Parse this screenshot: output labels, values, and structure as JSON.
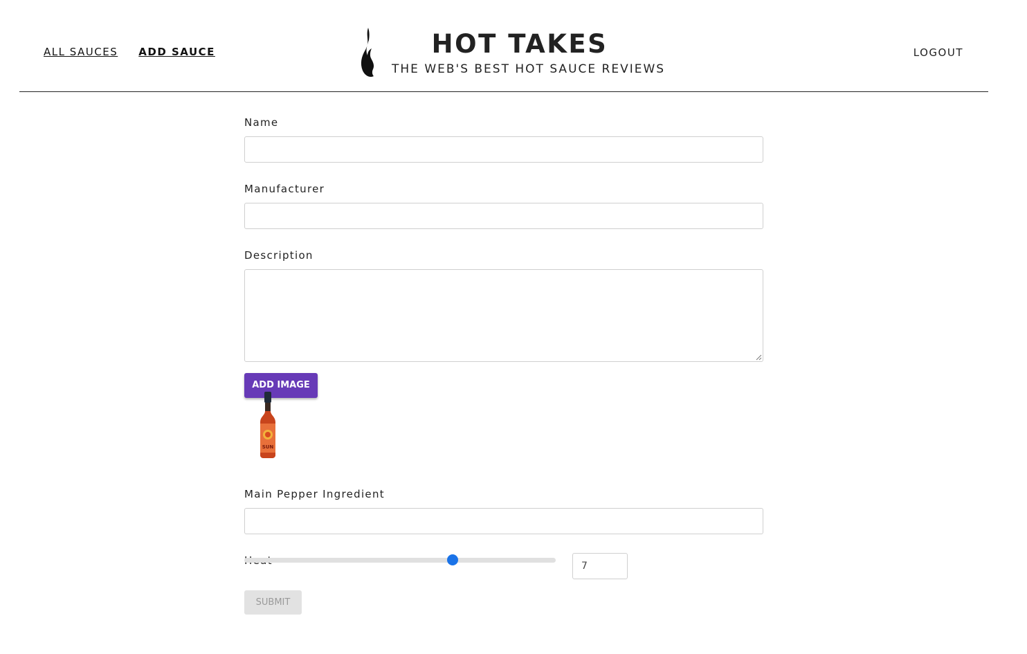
{
  "nav": {
    "all_sauces": "ALL SAUCES",
    "add_sauce": "ADD SAUCE",
    "logout": "LOGOUT"
  },
  "brand": {
    "title": "HOT TAKES",
    "subtitle": "THE WEB'S BEST HOT SAUCE REVIEWS",
    "logo_icon": "flame-icon"
  },
  "form": {
    "name_label": "Name",
    "name_value": "",
    "manufacturer_label": "Manufacturer",
    "manufacturer_value": "",
    "description_label": "Description",
    "description_value": "",
    "add_image_label": "ADD IMAGE",
    "image_preview": "hot-sauce-bottle-image",
    "bottle_label": "SUN",
    "pepper_label": "Main Pepper Ingredient",
    "pepper_value": "",
    "heat_label": "Heat",
    "heat_value": "7",
    "heat_min": 1,
    "heat_max": 10,
    "submit_label": "SUBMIT"
  },
  "colors": {
    "accent": "#673ab7",
    "slider": "#1a73e8",
    "disabled_bg": "#e2e2e2",
    "disabled_text": "#9a9a9a"
  }
}
